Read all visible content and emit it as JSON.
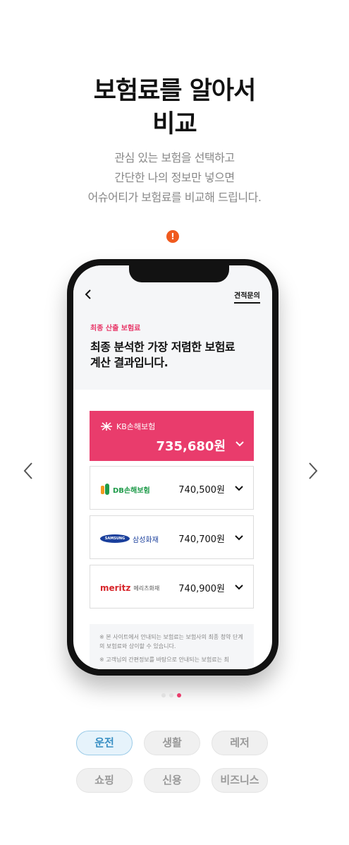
{
  "headline": {
    "line1": "보험료를 알아서",
    "line2": "비교"
  },
  "subtext": {
    "line1": "관심 있는 보험을 선택하고",
    "line2": "간단한 나의 정보만 넣으면",
    "line3": "어슈어티가 보험료를 비교해 드립니다."
  },
  "alert_icon": {
    "icon": "exclamation-icon",
    "glyph": "!",
    "color": "#f05a1e"
  },
  "phone": {
    "back_icon": "chevron-left-icon",
    "quote_link": "견적문의",
    "result_label": "최종 산출 보험료",
    "result_title": "최종 분석한 가장 저렴한 보험료\n계산 결과입니다.",
    "quotes": [
      {
        "insurer_mark": "KB",
        "insurer_name": "KB손해보험",
        "price": "735,680원",
        "highlight": true,
        "color": "#e93c6c"
      },
      {
        "insurer_mark": "DB",
        "insurer_name": "DB손해보험",
        "price": "740,500원",
        "highlight": false,
        "color": "#1f9b4a"
      },
      {
        "insurer_mark": "SAMSUNG",
        "insurer_name": "삼성화재",
        "price": "740,700원",
        "highlight": false,
        "color": "#1a3f9c"
      },
      {
        "insurer_mark": "meritz",
        "insurer_name": "메리츠화재",
        "price": "740,900원",
        "highlight": false,
        "color": "#d7262b"
      }
    ],
    "notices": [
      "※ 본 사이트에서 안내되는 보험료는 보험사의 최종 청약 단계의 보험료와 상이할 수 있습니다.",
      "※ 고객님의 간편정보를 바탕으로 안내되는 보험료는 최"
    ]
  },
  "carousel": {
    "total": 3,
    "active_index": 2,
    "accent": "#e93c6c"
  },
  "categories": [
    {
      "label": "운전",
      "active": true
    },
    {
      "label": "생활",
      "active": false
    },
    {
      "label": "레저",
      "active": false
    },
    {
      "label": "쇼핑",
      "active": false
    },
    {
      "label": "신용",
      "active": false
    },
    {
      "label": "비즈니스",
      "active": false
    }
  ]
}
